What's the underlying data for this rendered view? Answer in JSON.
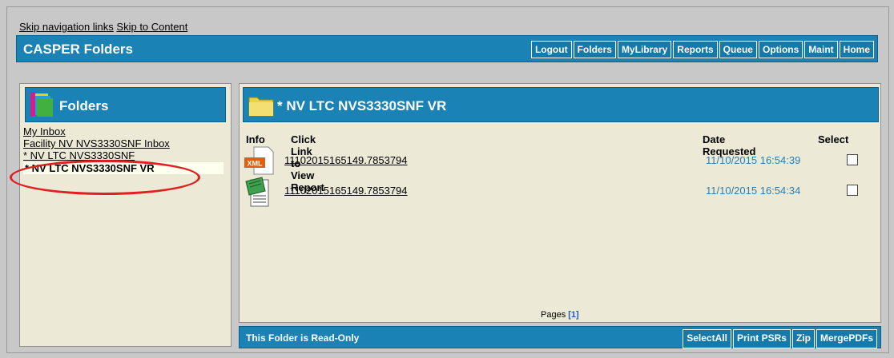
{
  "skip_links": [
    "Skip navigation links",
    "Skip to Content"
  ],
  "topbar": {
    "title": "CASPER Folders",
    "buttons": [
      "Logout",
      "Folders",
      "MyLibrary",
      "Reports",
      "Queue",
      "Options",
      "Maint",
      "Home"
    ]
  },
  "left_panel": {
    "title": "Folders",
    "items": [
      "My Inbox",
      "Facility NV NVS3330SNF Inbox",
      "* NV LTC NVS3330SNF"
    ],
    "selected": "* NV LTC NVS3330SNF VR"
  },
  "main_panel": {
    "title": "* NV LTC NVS3330SNF VR",
    "columns": {
      "info": "Info",
      "link": "Click Link to View Report",
      "date": "Date Requested",
      "select": "Select"
    },
    "rows": [
      {
        "icon": "xml-file-icon",
        "icon_text": "XML",
        "link": "11102015165149.7853794",
        "date": "11/10/2015 16:54:39"
      },
      {
        "icon": "notepad-file-icon",
        "link": "11102015165149.7853794",
        "date": "11/10/2015 16:54:34"
      }
    ],
    "pages_label": "Pages",
    "pages_link": "[1]"
  },
  "bottombar": {
    "message": "This Folder is Read-Only",
    "buttons": [
      "SelectAll",
      "Print PSRs",
      "Zip",
      "MergePDFs"
    ]
  },
  "colors": {
    "header_blue": "#1a82b4",
    "panel_bg": "#ece9d6",
    "annotation_red": "#e02020"
  }
}
